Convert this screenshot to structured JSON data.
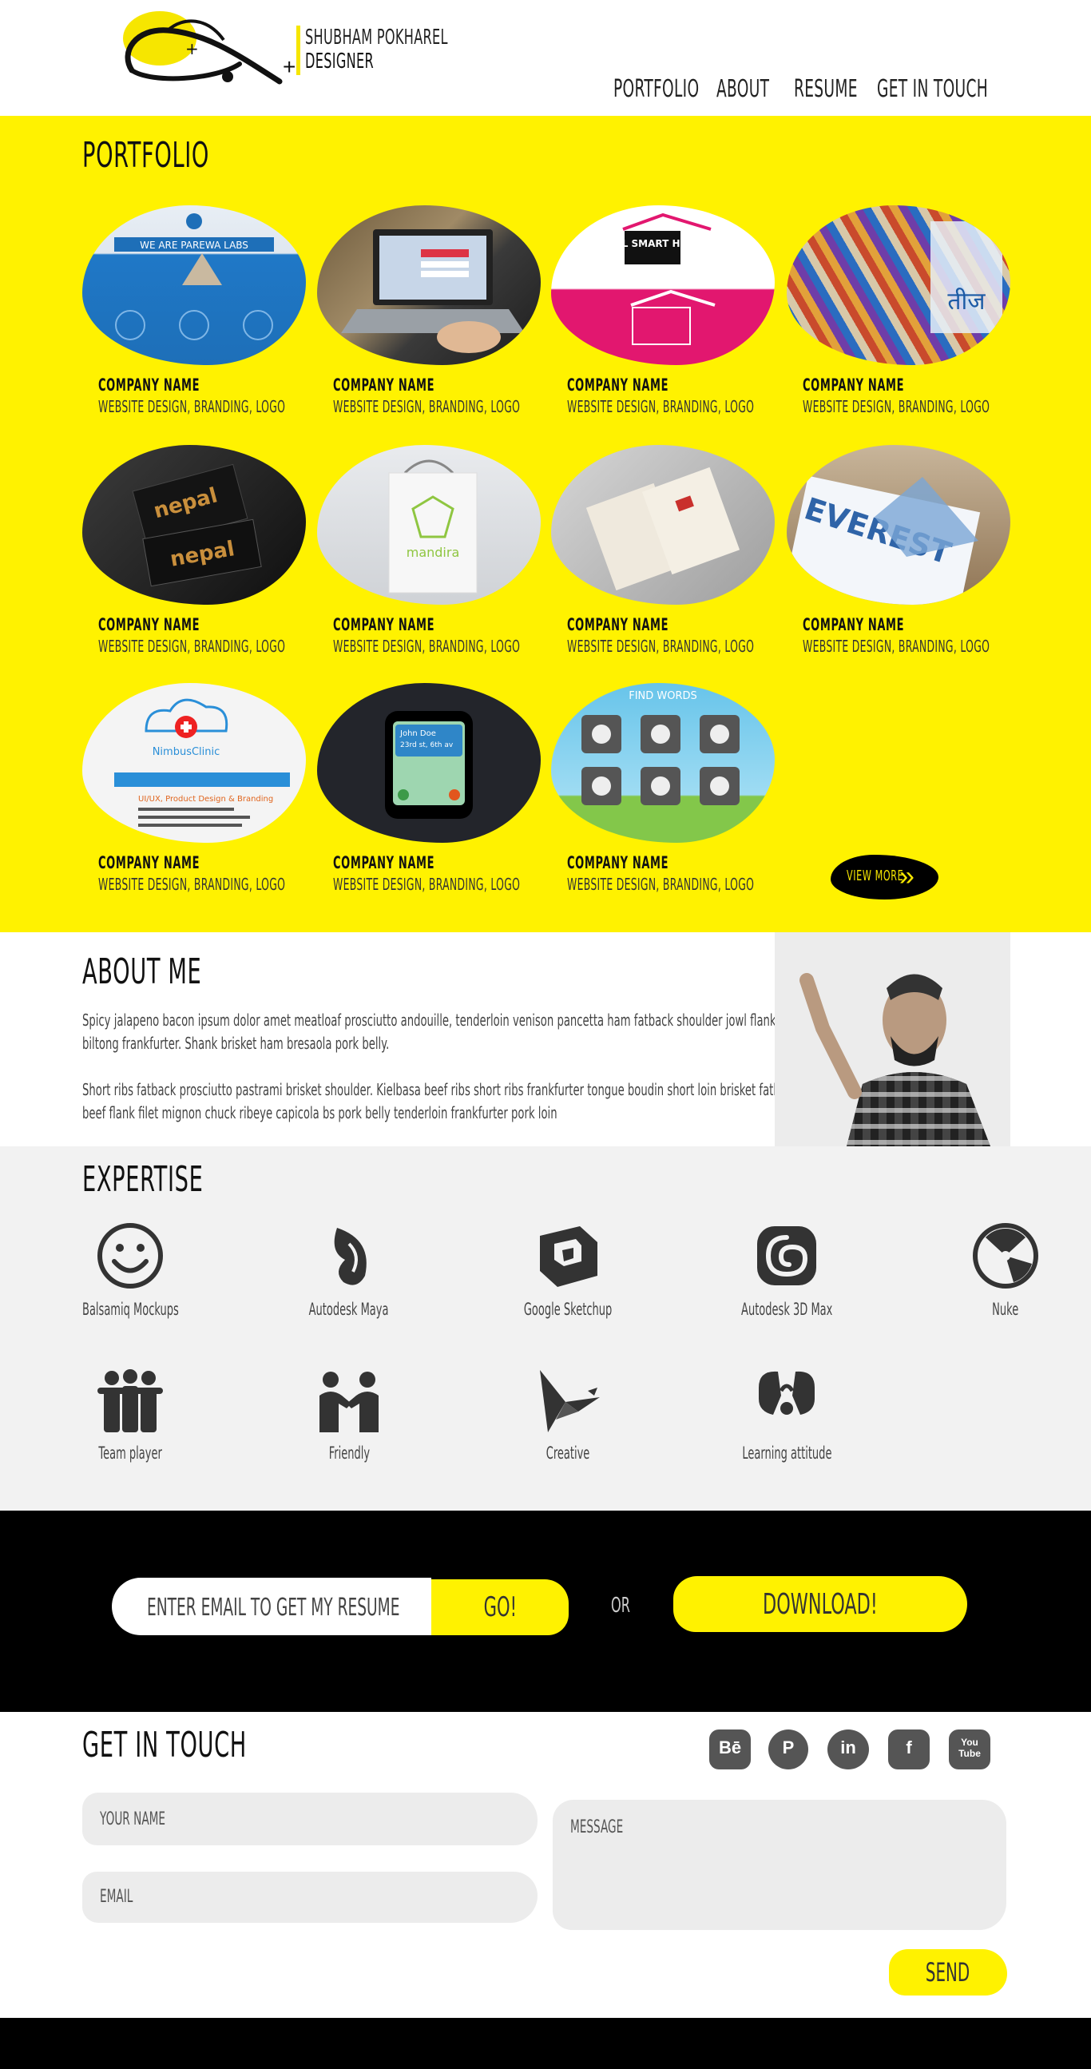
{
  "brand": {
    "name": "SHUBHAM POKHAREL",
    "role": "DESIGNER"
  },
  "nav": {
    "items": [
      "PORTFOLIO",
      "ABOUT",
      "RESUME",
      "GET IN TOUCH"
    ]
  },
  "portfolio": {
    "title": "PORTFOLIO",
    "items": [
      {
        "name": "COMPANY NAME",
        "tags": "WEBSITE DESIGN, BRANDING, LOGO",
        "thumb_text": "WE ARE PAREWA LABS"
      },
      {
        "name": "COMPANY NAME",
        "tags": "WEBSITE DESIGN, BRANDING, LOGO",
        "thumb_text": ""
      },
      {
        "name": "COMPANY NAME",
        "tags": "WEBSITE DESIGN, BRANDING, LOGO",
        "thumb_text": "NEPAL SMART HOMES"
      },
      {
        "name": "COMPANY NAME",
        "tags": "WEBSITE DESIGN, BRANDING, LOGO",
        "thumb_text": "तीज"
      },
      {
        "name": "COMPANY NAME",
        "tags": "WEBSITE DESIGN, BRANDING, LOGO",
        "thumb_text": "nepal"
      },
      {
        "name": "COMPANY NAME",
        "tags": "WEBSITE DESIGN, BRANDING, LOGO",
        "thumb_text": "mandira"
      },
      {
        "name": "COMPANY NAME",
        "tags": "WEBSITE DESIGN, BRANDING, LOGO",
        "thumb_text": ""
      },
      {
        "name": "COMPANY NAME",
        "tags": "WEBSITE DESIGN, BRANDING, LOGO",
        "thumb_text": "EVEREST"
      },
      {
        "name": "COMPANY NAME",
        "tags": "WEBSITE DESIGN, BRANDING, LOGO",
        "thumb_text": "NimbusClinic"
      },
      {
        "name": "COMPANY NAME",
        "tags": "WEBSITE DESIGN, BRANDING, LOGO",
        "thumb_text": "John Doe"
      },
      {
        "name": "COMPANY NAME",
        "tags": "WEBSITE DESIGN, BRANDING, LOGO",
        "thumb_text": "FIND WORDS"
      }
    ],
    "view_more": "VIEW MORE"
  },
  "about": {
    "title": "ABOUT ME",
    "para1": "Spicy jalapeno bacon ipsum dolor amet meatloaf prosciutto andouille, tenderloin venison pancetta ham fatback shoulder jowl flank biltong frankfurter. Shank brisket ham bresaola pork belly.",
    "para2": "Short ribs fatback prosciutto pastrami brisket shoulder. Kielbasa beef ribs short ribs frankfurter tongue boudin short loin brisket fatback beef flank filet mignon chuck ribeye capicola bs pork belly tenderloin frankfurter pork loin"
  },
  "expertise": {
    "title": "EXPERTISE",
    "skills": [
      {
        "label": "Balsamiq Mockups",
        "icon": "smiley-icon"
      },
      {
        "label": "Autodesk Maya",
        "icon": "maya-icon"
      },
      {
        "label": "Google Sketchup",
        "icon": "sketchup-icon"
      },
      {
        "label": "Autodesk 3D Max",
        "icon": "3dmax-icon"
      },
      {
        "label": "Nuke",
        "icon": "nuke-icon"
      },
      {
        "label": "Team player",
        "icon": "team-icon"
      },
      {
        "label": "Friendly",
        "icon": "friendly-icon"
      },
      {
        "label": "Creative",
        "icon": "bird-icon"
      },
      {
        "label": "Learning attitude",
        "icon": "brain-icon"
      }
    ]
  },
  "resume": {
    "email_placeholder": "ENTER EMAIL TO GET MY RESUME",
    "go_label": "GO!",
    "or_label": "OR",
    "download_label": "DOWNLOAD!"
  },
  "contact": {
    "title": "GET IN TOUCH",
    "social": [
      "Bē",
      "P",
      "in",
      "f",
      "You Tube"
    ],
    "name_placeholder": "YOUR NAME",
    "email_placeholder": "EMAIL",
    "message_placeholder": "MESSAGE",
    "send_label": "SEND"
  },
  "colors": {
    "accent": "#fff200",
    "dark": "#000000",
    "light_section": "#f2f2f2"
  }
}
